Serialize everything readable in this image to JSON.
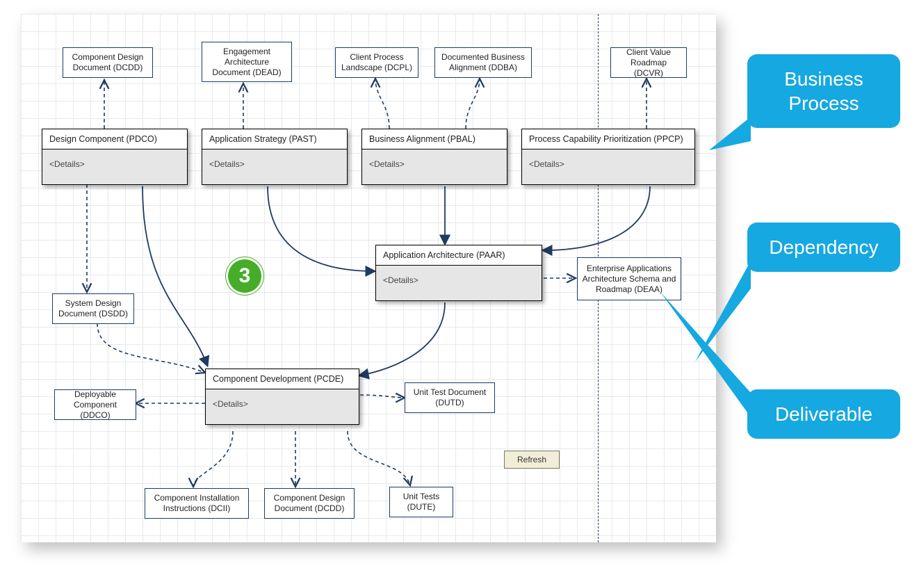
{
  "deliverables": {
    "dcdd_top": "Component Design Document (DCDD)",
    "dead": "Engagement Architecture Document (DEAD)",
    "dcpl": "Client Process Landscape (DCPL)",
    "ddba": "Documented Business Alignment (DDBA)",
    "dcvr": "Client Value Roadmap (DCVR)",
    "dsdd": "System Design Document (DSDD)",
    "deaa": "Enterprise Applications Architecture Schema and Roadmap (DEAA)",
    "ddco": "Deployable Component (DDCO)",
    "dutd": "Unit Test Document (DUTD)",
    "dcii": "Component Installation Instructions (DCII)",
    "dcdd_bot": "Component Design Document (DCDD)",
    "dute": "Unit Tests (DUTE)"
  },
  "processes": {
    "pdco": {
      "title": "Design Component (PDCO)",
      "body": "<Details>"
    },
    "past": {
      "title": "Application Strategy (PAST)",
      "body": "<Details>"
    },
    "pbal": {
      "title": "Business Alignment (PBAL)",
      "body": "<Details>"
    },
    "ppcp": {
      "title": "Process Capability Prioritization (PPCP)",
      "body": "<Details>"
    },
    "paar": {
      "title": "Application Architecture (PAAR)",
      "body": "<Details>"
    },
    "pcde": {
      "title": "Component Development (PCDE)",
      "body": "<Details>"
    }
  },
  "buttons": {
    "refresh": "Refresh"
  },
  "badge": "3",
  "callouts": {
    "business_process": "Business\nProcess",
    "dependency": "Dependency",
    "deliverable": "Deliverable"
  }
}
